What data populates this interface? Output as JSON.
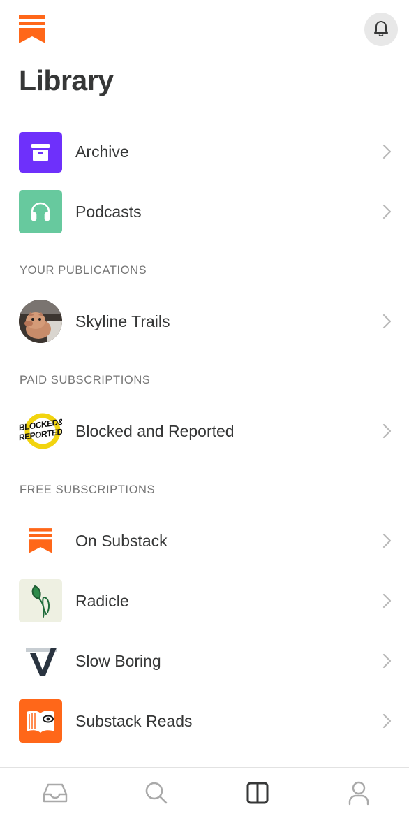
{
  "header": {
    "title": "Library",
    "logo_icon": "substack-logo",
    "notifications_icon": "bell-icon"
  },
  "items": {
    "archive": {
      "label": "Archive",
      "icon": "archive-box-icon",
      "color": "#6e30fb"
    },
    "podcasts": {
      "label": "Podcasts",
      "icon": "headphones-icon",
      "color": "#67c99e"
    }
  },
  "sections": {
    "your_publications": {
      "title": "YOUR PUBLICATIONS",
      "items": [
        {
          "label": "Skyline Trails",
          "icon": "piglet-avatar"
        }
      ]
    },
    "paid_subscriptions": {
      "title": "PAID SUBSCRIPTIONS",
      "items": [
        {
          "label": "Blocked and Reported",
          "icon": "blocked-and-reported-logo",
          "logo_text_1": "BLOCKED&",
          "logo_text_2": "REPORTED"
        }
      ]
    },
    "free_subscriptions": {
      "title": "FREE SUBSCRIPTIONS",
      "items": [
        {
          "label": "On Substack",
          "icon": "substack-logo"
        },
        {
          "label": "Radicle",
          "icon": "sprout-logo"
        },
        {
          "label": "Slow Boring",
          "icon": "slow-boring-logo"
        },
        {
          "label": "Substack Reads",
          "icon": "open-book-eye-logo"
        }
      ]
    }
  },
  "tabbar": {
    "tabs": [
      {
        "name": "inbox",
        "icon": "inbox-icon",
        "active": false
      },
      {
        "name": "search",
        "icon": "search-icon",
        "active": false
      },
      {
        "name": "library",
        "icon": "library-icon",
        "active": true
      },
      {
        "name": "profile",
        "icon": "profile-icon",
        "active": false
      }
    ]
  },
  "colors": {
    "brand": "#ff6719",
    "text": "#363737",
    "secondary_text": "#767676",
    "chevron": "#b9b9b9"
  }
}
